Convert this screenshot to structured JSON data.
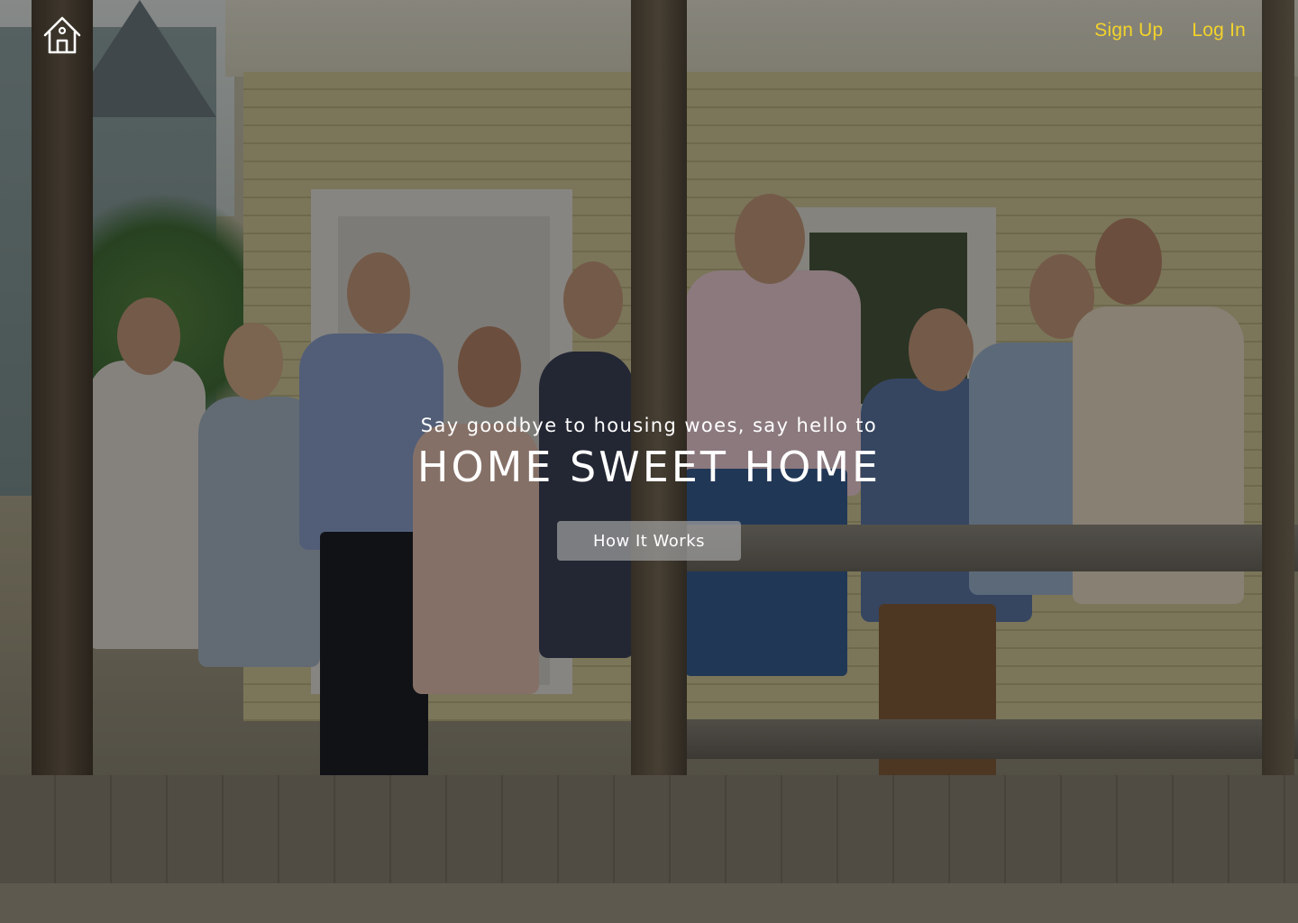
{
  "header": {
    "home_icon": "house-outline-icon",
    "sign_up_label": "Sign Up",
    "log_in_label": "Log In",
    "link_color": "#f3d32a"
  },
  "hero": {
    "tagline": "Say goodbye to housing woes, say hello to",
    "headline": "HOME SWEET HOME",
    "cta_label": "How It Works",
    "background_image": "group-of-friends-on-porch-photo"
  }
}
